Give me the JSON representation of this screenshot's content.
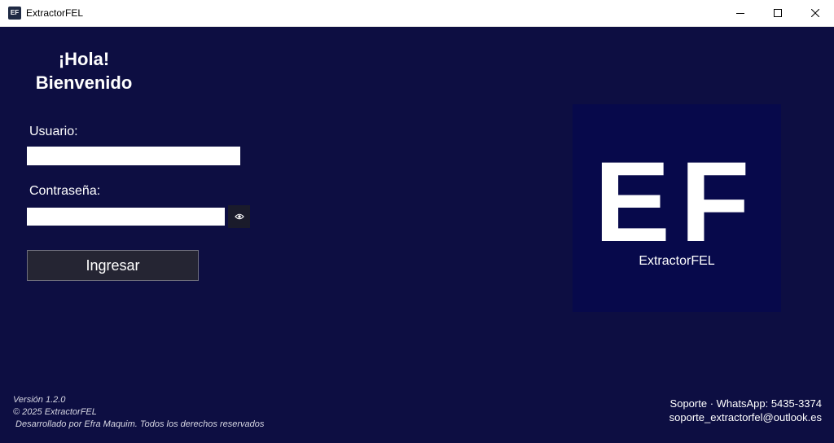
{
  "window": {
    "title": "ExtractorFEL",
    "icon_text": "EF",
    "controls": [
      "minimize-icon",
      "maximize-icon",
      "close-icon"
    ]
  },
  "greeting": {
    "line1": "¡Hola!",
    "line2": "Bienvenido"
  },
  "form": {
    "username_label": "Usuario:",
    "username_value": "",
    "password_label": "Contraseña:",
    "password_value": "",
    "show_password_icon": "eye-icon",
    "submit_label": "Ingresar"
  },
  "logo": {
    "letters": "EF",
    "name": "ExtractorFEL"
  },
  "footer": {
    "version": "Versión 1.2.0",
    "copyright": "© 2025 ExtractorFEL",
    "credits": " Desarrollado por Efra Maquim. Todos los derechos reservados",
    "support": "Soporte · WhatsApp: 5435-3374",
    "email": "soporte_extractorfel@outlook.es"
  },
  "colors": {
    "background": "#0d0e42",
    "logo_background": "#07094b",
    "button_background": "#252533",
    "text": "#ffffff"
  }
}
